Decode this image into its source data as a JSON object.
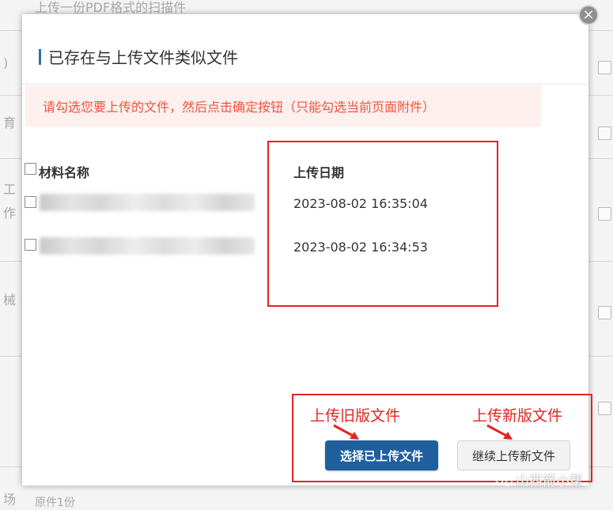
{
  "background": {
    "top_text": "上传一份PDF格式的扫描件",
    "left_fragments": [
      ")",
      "育",
      "工",
      "作",
      "械",
      "场"
    ],
    "bottom_text": "原件1份"
  },
  "modal": {
    "title": "已存在与上传文件类似文件",
    "close_icon": "×",
    "notice": "请勾选您要上传的文件，然后点击确定按钮（只能勾选当前页面附件）",
    "columns": {
      "name": "材料名称",
      "date": "上传日期"
    },
    "rows": [
      {
        "name": "",
        "date": "2023-08-02 16:35:04"
      },
      {
        "name": "",
        "date": "2023-08-02 16:34:53"
      }
    ],
    "buttons": {
      "select_uploaded": "选择已上传文件",
      "continue_new": "继续上传新文件"
    }
  },
  "annotations": {
    "old_version": "上传旧版文件",
    "new_version": "上传新版文件",
    "highlight_color": "#e52323"
  },
  "watermark": "山西箭小帮"
}
